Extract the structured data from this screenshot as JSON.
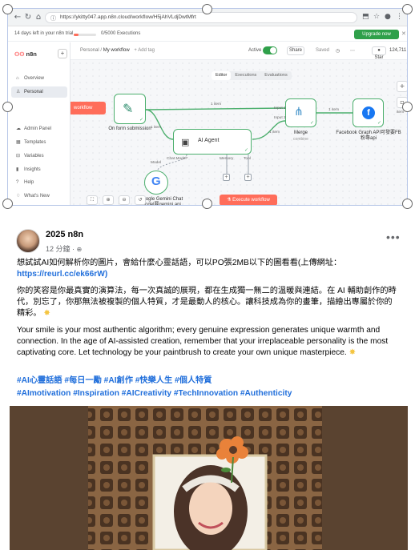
{
  "browser": {
    "url": "https://ykitty047.app.n8n.cloud/workflow/H5jAhVLdjDwtMfrt"
  },
  "trial": {
    "days_left": "14 days left in your n8n trial",
    "executions": "0/5000 Executions",
    "upgrade": "Upgrade now"
  },
  "sidebar": {
    "app_name": "n8n",
    "items": [
      {
        "label": "Overview",
        "icon": "home-icon"
      },
      {
        "label": "Personal",
        "icon": "user-icon"
      },
      {
        "label": "Admin Panel",
        "icon": "cloud-icon"
      },
      {
        "label": "Templates",
        "icon": "template-icon"
      },
      {
        "label": "Variables",
        "icon": "variables-icon"
      },
      {
        "label": "Insights",
        "icon": "insights-icon"
      },
      {
        "label": "Help",
        "icon": "help-icon"
      },
      {
        "label": "What's New",
        "icon": "bell-icon"
      }
    ]
  },
  "topbar": {
    "crumb_personal": "Personal",
    "crumb_workflow": "My workflow",
    "add_tag": "+ Add tag",
    "active_label": "Active",
    "share": "Share",
    "saved": "Saved",
    "star": "Star",
    "star_count": "124,711"
  },
  "canvas": {
    "tabs": [
      "Editor",
      "Executions",
      "Evaluations"
    ],
    "red_tab": "workflow",
    "nodes": {
      "form": "On form submission",
      "agent": "AI Agent",
      "merge": "Merge",
      "merge_sub": "combine",
      "facebook": "Facebook Graph API可發要FB粉專api",
      "gemini": "Google Gemini Chat Model要gemini api"
    },
    "edge_labels": {
      "e1": "1 item",
      "e2": "1 item",
      "e3": "1 item",
      "e4": "1 item",
      "input1": "Input 1",
      "input2": "Input 2"
    },
    "ports": {
      "chat_model": "Chat Model*",
      "memory": "Memory",
      "tool": "Tool",
      "model": "Model"
    },
    "execute_button": "Execute workflow",
    "right_edge_item": "item"
  },
  "post": {
    "author": "2025 n8n",
    "meta": "12 分鐘 · ",
    "line1": "想試試AI如何解析你的圖片，會給什麼心靈話語，可以PO張2MB以下的圖看看(上傳網址：",
    "link": "https://reurl.cc/ek66rW)",
    "para_zh": "你的笑容是你最真實的演算法，每一次真誠的展現，都在生成獨一無二的溫暖與連結。在 AI 輔助創作的時代，別忘了，你那無法被複製的個人特質，才是最動人的核心。讓科技成為你的畫筆，描繪出專屬於你的精彩。",
    "para_en": "Your smile is your most authentic algorithm; every genuine expression generates unique warmth and connection. In the age of AI-assisted creation, remember that your irreplaceable personality is the most captivating core. Let technology be your paintbrush to create your own unique masterpiece.",
    "hashtags_zh": "#AI心靈話語 #每日一勵 #AI創作 #快樂人生 #個人特質",
    "hashtags_en": "#AImotivation #Inspiration #AICreativity #TechInnovation #Authenticity"
  }
}
